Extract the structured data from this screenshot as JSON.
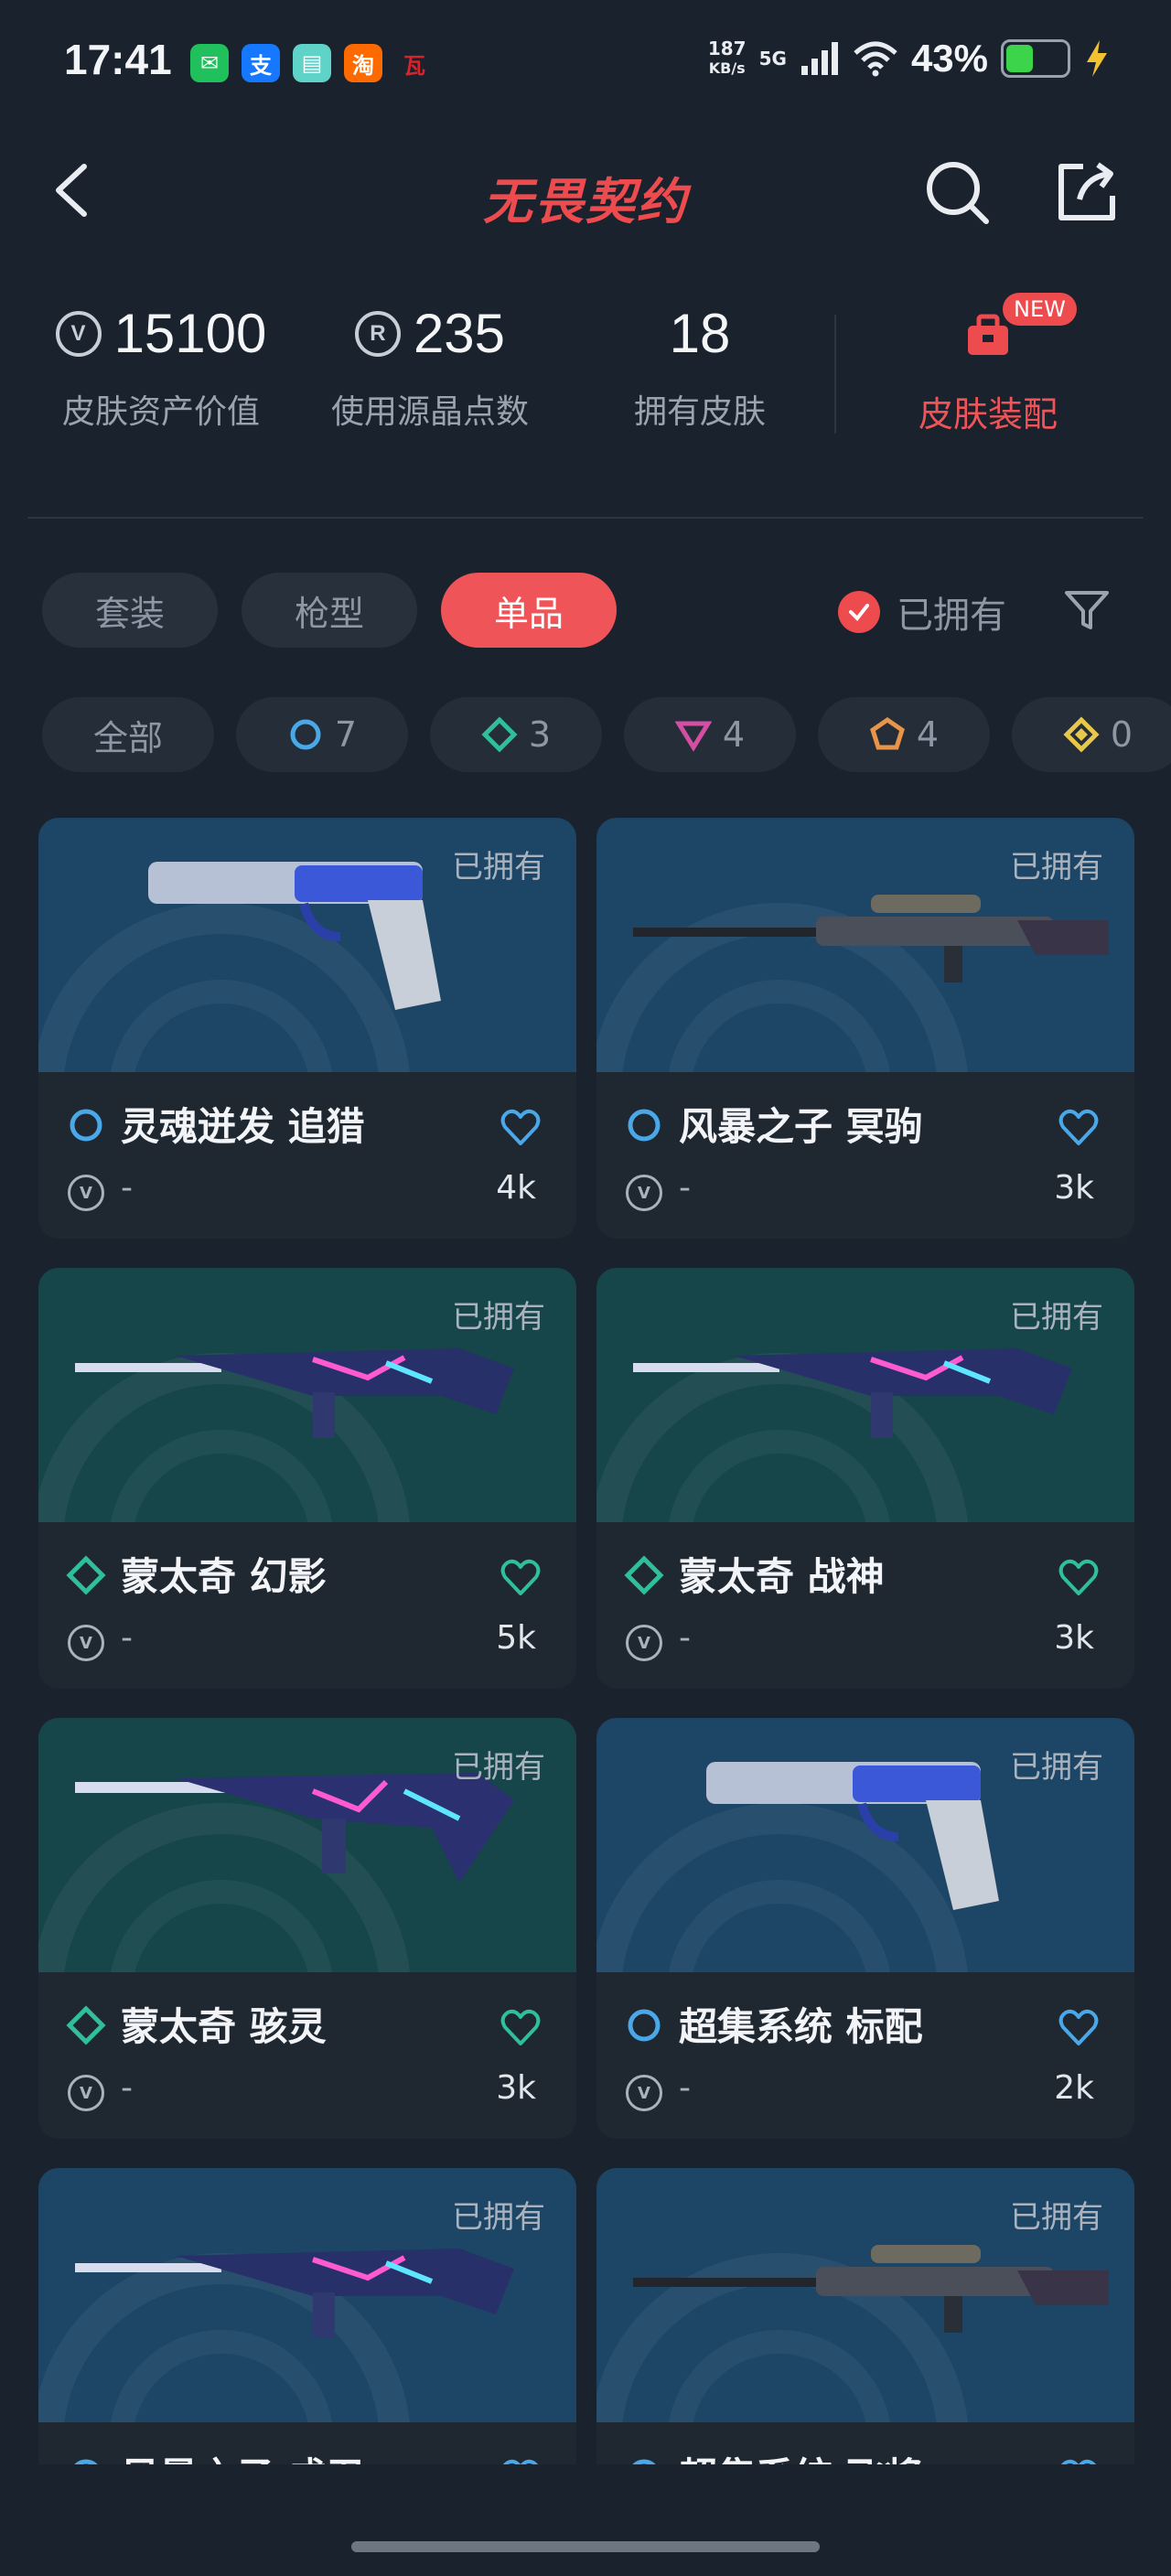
{
  "status_bar": {
    "time": "17:41",
    "apps": [
      {
        "icon": "wechat-icon",
        "glyph": "✉",
        "color": "#20c05c"
      },
      {
        "icon": "alipay-icon",
        "glyph": "支",
        "color": "#1677ff"
      },
      {
        "icon": "app-icon",
        "glyph": "▤",
        "color": "#5fd3c8"
      },
      {
        "icon": "taobao-icon",
        "glyph": "淘",
        "color": "#ff6a00"
      },
      {
        "icon": "app-logo-icon",
        "glyph": "瓦",
        "color": "#d8232a"
      }
    ],
    "net_speed_value": "187",
    "net_speed_unit": "KB/s",
    "network": "5G",
    "battery": "43%",
    "battery_level": 0.43
  },
  "header": {
    "title": "无畏契约"
  },
  "stats": [
    {
      "value": "15100",
      "label": "皮肤资产价值",
      "icon": "vp-icon"
    },
    {
      "value": "235",
      "label": "使用源晶点数",
      "icon": "radianite-icon"
    },
    {
      "value": "18",
      "label": "拥有皮肤",
      "icon": ""
    }
  ],
  "loadout": {
    "label": "皮肤装配",
    "badge": "NEW"
  },
  "tabs": [
    {
      "label": "套装",
      "active": false
    },
    {
      "label": "枪型",
      "active": false
    },
    {
      "label": "单品",
      "active": true
    }
  ],
  "owned_filter": {
    "label": "已拥有",
    "checked": true
  },
  "tier_chips": [
    {
      "label": "全部",
      "icon": ""
    },
    {
      "count": "7",
      "icon": "select-tier-icon",
      "color": "#4aa8e8"
    },
    {
      "count": "3",
      "icon": "deluxe-tier-icon",
      "color": "#2fbf9a"
    },
    {
      "count": "4",
      "icon": "premium-tier-icon",
      "color": "#d44fa3"
    },
    {
      "count": "4",
      "icon": "exclusive-tier-icon",
      "color": "#e8954a"
    },
    {
      "count": "0",
      "icon": "ultra-tier-icon",
      "color": "#e8c84a"
    }
  ],
  "skins": [
    {
      "name": "灵魂迸发 追猎",
      "tier": "select",
      "tier_color": "#4aa8e8",
      "owned": "已拥有",
      "price": "-",
      "likes": "4k",
      "bg": "#1c4566",
      "weapon": "pistol"
    },
    {
      "name": "风暴之子 冥驹",
      "tier": "select",
      "tier_color": "#4aa8e8",
      "owned": "已拥有",
      "price": "-",
      "likes": "3k",
      "bg": "#1c4566",
      "weapon": "sniper"
    },
    {
      "name": "蒙太奇 幻影",
      "tier": "deluxe",
      "tier_color": "#2fbf9a",
      "owned": "已拥有",
      "price": "-",
      "likes": "5k",
      "bg": "#16454a",
      "weapon": "rifle"
    },
    {
      "name": "蒙太奇 战神",
      "tier": "deluxe",
      "tier_color": "#2fbf9a",
      "owned": "已拥有",
      "price": "-",
      "likes": "3k",
      "bg": "#16454a",
      "weapon": "rifle"
    },
    {
      "name": "蒙太奇 骇灵",
      "tier": "deluxe",
      "tier_color": "#2fbf9a",
      "owned": "已拥有",
      "price": "-",
      "likes": "3k",
      "bg": "#16454a",
      "weapon": "smg"
    },
    {
      "name": "超集系统 标配",
      "tier": "select",
      "tier_color": "#4aa8e8",
      "owned": "已拥有",
      "price": "-",
      "likes": "2k",
      "bg": "#1c4566",
      "weapon": "pistol"
    },
    {
      "name": "风暴之子 戍卫",
      "tier": "select",
      "tier_color": "#4aa8e8",
      "owned": "已拥有",
      "price": "-",
      "likes": "",
      "bg": "#1c4566",
      "weapon": "rifle"
    },
    {
      "name": "超集系统 飞将",
      "tier": "select",
      "tier_color": "#4aa8e8",
      "owned": "已拥有",
      "price": "-",
      "likes": "",
      "bg": "#1c4566",
      "weapon": "sniper"
    }
  ]
}
